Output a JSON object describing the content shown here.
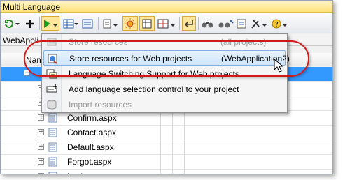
{
  "window": {
    "title": "Multi Language"
  },
  "toolbar": {
    "buttons": [
      {
        "name": "refresh-dropdown-button",
        "icon": "refresh-icon"
      },
      {
        "name": "add-button",
        "icon": "plus-icon"
      },
      {
        "name": "run-dropdown-button",
        "icon": "play-icon"
      },
      {
        "name": "grid-view-button",
        "icon": "grid-icon"
      },
      {
        "name": "form-view-button",
        "icon": "form-icon"
      },
      {
        "name": "options-dropdown-button",
        "icon": "list-icon"
      },
      {
        "name": "highlight-button",
        "icon": "sun-icon"
      },
      {
        "name": "columns-button",
        "icon": "columns-icon"
      },
      {
        "name": "layout-dropdown-button",
        "icon": "layout-icon"
      },
      {
        "name": "return-button",
        "icon": "return-icon"
      },
      {
        "name": "find-button",
        "icon": "binoculars-icon"
      },
      {
        "name": "find-replace-button",
        "icon": "binoculars-replace-icon"
      },
      {
        "name": "properties-button",
        "icon": "properties-icon"
      },
      {
        "name": "tools-dropdown-button",
        "icon": "tools-icon"
      },
      {
        "name": "help-button",
        "icon": "help-icon"
      }
    ]
  },
  "tab": {
    "label": "WebAppli"
  },
  "grid": {
    "header": {
      "name_col": "Nam"
    },
    "rows": [
      {
        "label": "",
        "selected": true
      },
      {
        "label": "",
        "selected": false
      },
      {
        "label": "",
        "selected": false
      },
      {
        "label": "Confirm.aspx",
        "selected": false
      },
      {
        "label": "Contact.aspx",
        "selected": false
      },
      {
        "label": "Default.aspx",
        "selected": false
      },
      {
        "label": "Forgot.aspx",
        "selected": false
      },
      {
        "label": "Lockout.aspx",
        "selected": false
      }
    ]
  },
  "menu": {
    "items": [
      {
        "label": "Store resources",
        "shortcut": "(all projects)",
        "disabled": true,
        "hover": false,
        "icon": "store-icon"
      },
      {
        "label": "Store resources for Web projects",
        "shortcut": "(WebApplication2)",
        "disabled": false,
        "hover": true,
        "icon": "store-web-icon"
      },
      {
        "label": "Language Switching Support for Web projects",
        "shortcut": "",
        "disabled": false,
        "hover": false,
        "icon": "language-switch-icon"
      },
      {
        "label": "Add language selection control to your project",
        "shortcut": "",
        "disabled": false,
        "hover": false,
        "icon": "add-control-icon"
      },
      {
        "label": "Import resources",
        "shortcut": "",
        "disabled": true,
        "hover": false,
        "icon": "database-icon"
      }
    ]
  },
  "colors": {
    "title_bg": "#ffe27a",
    "selection": "#3399ff",
    "hover_border": "#84acdd",
    "callout": "#d11b1b"
  }
}
